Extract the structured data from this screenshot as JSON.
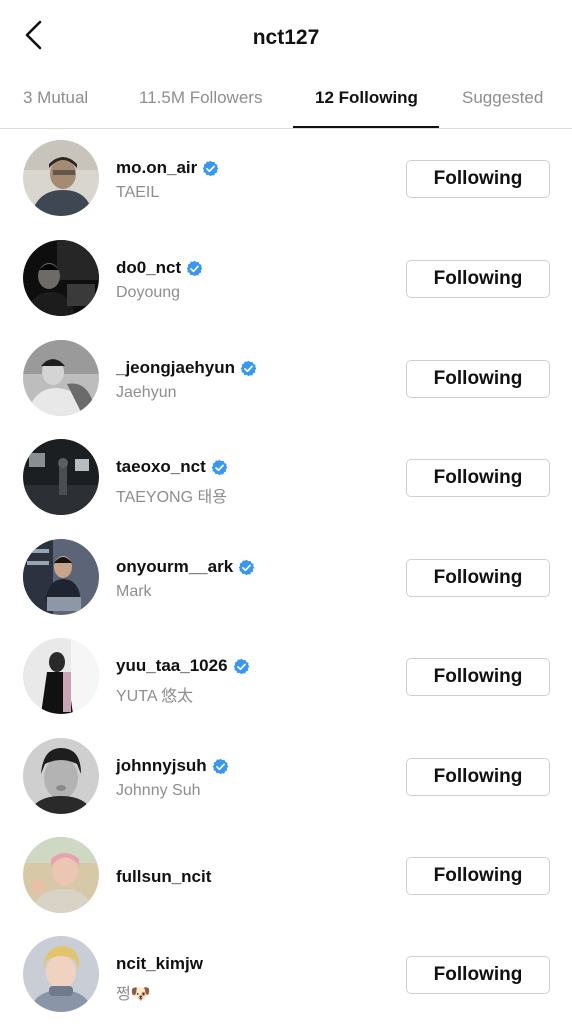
{
  "header": {
    "title": "nct127"
  },
  "tabs": [
    {
      "label": "3 Mutual"
    },
    {
      "label": "11.5M Followers"
    },
    {
      "label": "12 Following"
    },
    {
      "label": "Suggested"
    }
  ],
  "users": [
    {
      "handle": "mo.on_air",
      "name": "TAEIL",
      "verified": true,
      "button": "Following"
    },
    {
      "handle": "do0_nct",
      "name": "Doyoung",
      "verified": true,
      "button": "Following"
    },
    {
      "handle": "_jeongjaehyun",
      "name": "Jaehyun",
      "verified": true,
      "button": "Following"
    },
    {
      "handle": "taeoxo_nct",
      "name": "TAEYONG 태용",
      "verified": true,
      "button": "Following"
    },
    {
      "handle": "onyourm__ark",
      "name": "Mark",
      "verified": true,
      "button": "Following"
    },
    {
      "handle": "yuu_taa_1026",
      "name": "YUTA 悠太",
      "verified": true,
      "button": "Following"
    },
    {
      "handle": "johnnyjsuh",
      "name": "Johnny Suh",
      "verified": true,
      "button": "Following"
    },
    {
      "handle": "fullsun_ncit",
      "name": "",
      "verified": false,
      "button": "Following"
    },
    {
      "handle": "ncit_kimjw",
      "name": "쩡🐶",
      "verified": false,
      "button": "Following"
    }
  ],
  "colors": {
    "verified": "#3897f0",
    "text": "#262626",
    "muted": "#8e8e8e",
    "border": "#dbdbdb"
  },
  "icons": {
    "back": "chevron-left-icon",
    "verified": "verified-badge-icon"
  }
}
